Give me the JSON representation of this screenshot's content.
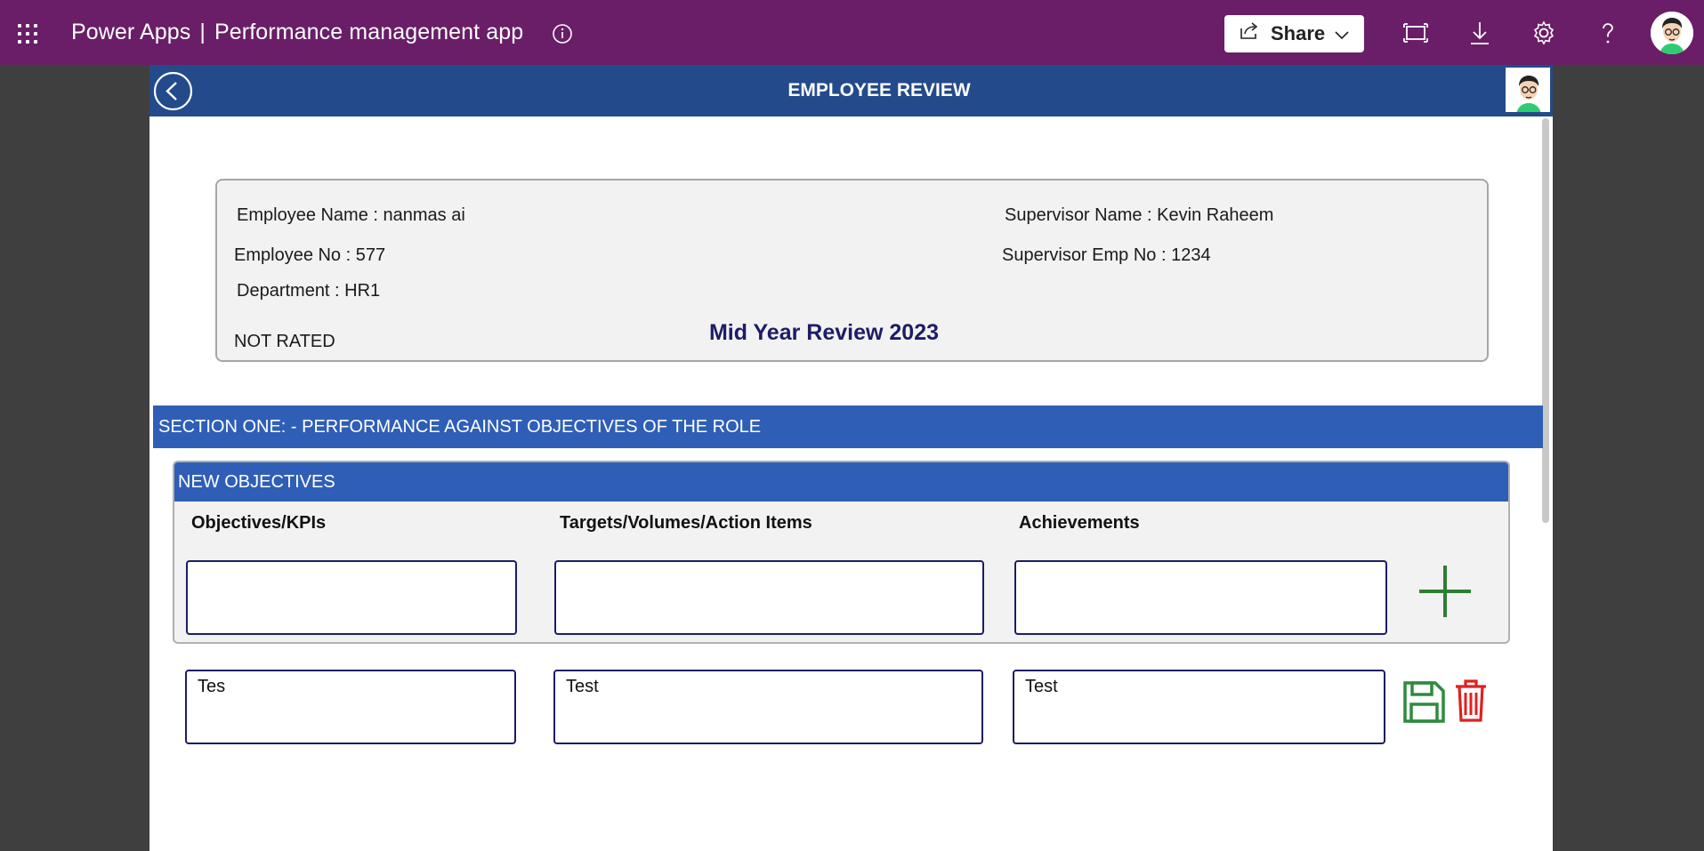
{
  "topbar": {
    "app_name": "Power Apps",
    "separator": "|",
    "app_title": "Performance management app",
    "share_label": "Share",
    "bg_color": "#691e67"
  },
  "header": {
    "title": "EMPLOYEE REVIEW",
    "bg_color": "#234a8a"
  },
  "employee": {
    "name_line": "Employee Name : nanmas ai",
    "number_line": "Employee No : 577",
    "department_line": "Department : HR1",
    "supervisor_name_line": "Supervisor Name : Kevin Raheem",
    "supervisor_emp_line": "Supervisor Emp No : 1234",
    "rating_status": "NOT RATED",
    "review_title": "Mid Year Review 2023"
  },
  "section_one": {
    "title": "SECTION ONE: - PERFORMANCE AGAINST OBJECTIVES OF THE ROLE",
    "new_objectives": {
      "title": "NEW OBJECTIVES",
      "columns": [
        "Objectives/KPIs",
        "Targets/Volumes/Action Items",
        "Achievements"
      ],
      "inputs": [
        "",
        "",
        ""
      ]
    },
    "rows": [
      {
        "objective": "Tes",
        "target": "Test",
        "achievement": "Test"
      }
    ]
  },
  "icons": {
    "waffle": "app-launcher-icon",
    "info": "info-icon",
    "share": "share-icon",
    "fit": "fit-to-window-icon",
    "download": "download-icon",
    "settings": "gear-icon",
    "help": "help-icon",
    "back": "back-arrow-icon",
    "add": "plus-icon",
    "save": "save-icon",
    "delete": "trash-icon"
  },
  "colors": {
    "section_blue": "#2f5eb7",
    "add_green": "#2e7d32",
    "save_green": "#2e8b3e",
    "delete_red": "#e02020",
    "review_title": "#1c1c66"
  }
}
